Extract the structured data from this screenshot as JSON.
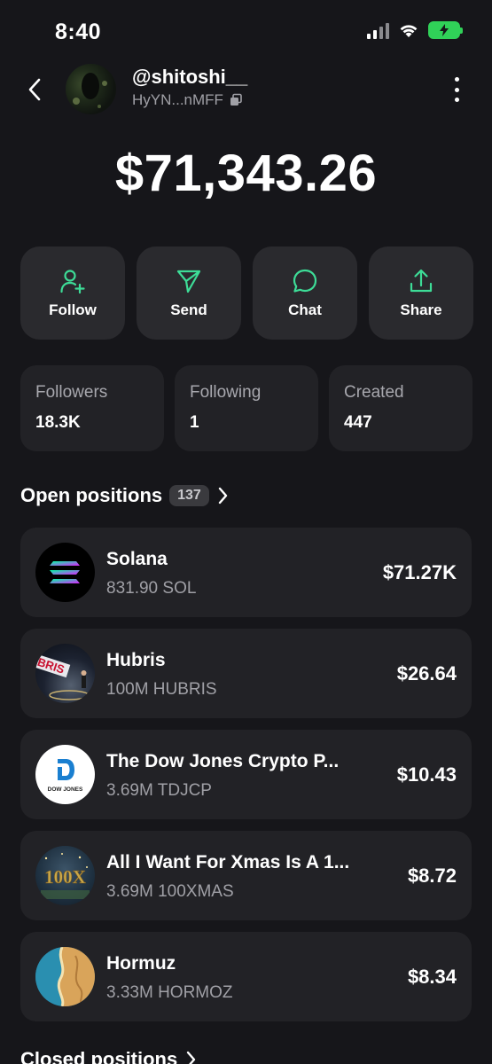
{
  "status": {
    "time": "8:40"
  },
  "profile": {
    "username": "@shitoshi__",
    "address": "HyYN...nMFF"
  },
  "balance": "$71,343.26",
  "actions": [
    {
      "label": "Follow",
      "icon": "user-plus-icon"
    },
    {
      "label": "Send",
      "icon": "send-icon"
    },
    {
      "label": "Chat",
      "icon": "chat-bubble-icon"
    },
    {
      "label": "Share",
      "icon": "share-icon"
    }
  ],
  "stats": [
    {
      "label": "Followers",
      "value": "18.3K"
    },
    {
      "label": "Following",
      "value": "1"
    },
    {
      "label": "Created",
      "value": "447"
    }
  ],
  "open_positions": {
    "title": "Open positions",
    "count": "137",
    "items": [
      {
        "name": "Solana",
        "amount": "831.90 SOL",
        "value": "$71.27K",
        "icon": "solana-logo"
      },
      {
        "name": "Hubris",
        "amount": "100M HUBRIS",
        "value": "$26.64",
        "icon": "hubris-logo",
        "icon_text": "BRIS"
      },
      {
        "name": "The Dow Jones Crypto P...",
        "amount": "3.69M TDJCP",
        "value": "$10.43",
        "icon": "dow-jones-logo",
        "icon_text": "DOW JONES"
      },
      {
        "name": "All I Want For Xmas Is A 1...",
        "amount": "3.69M 100XMAS",
        "value": "$8.72",
        "icon": "100x-logo",
        "icon_text": "100X"
      },
      {
        "name": "Hormuz",
        "amount": "3.33M HORMOZ",
        "value": "$8.34",
        "icon": "hormuz-logo"
      }
    ]
  },
  "closed_positions": {
    "title": "Closed positions"
  }
}
